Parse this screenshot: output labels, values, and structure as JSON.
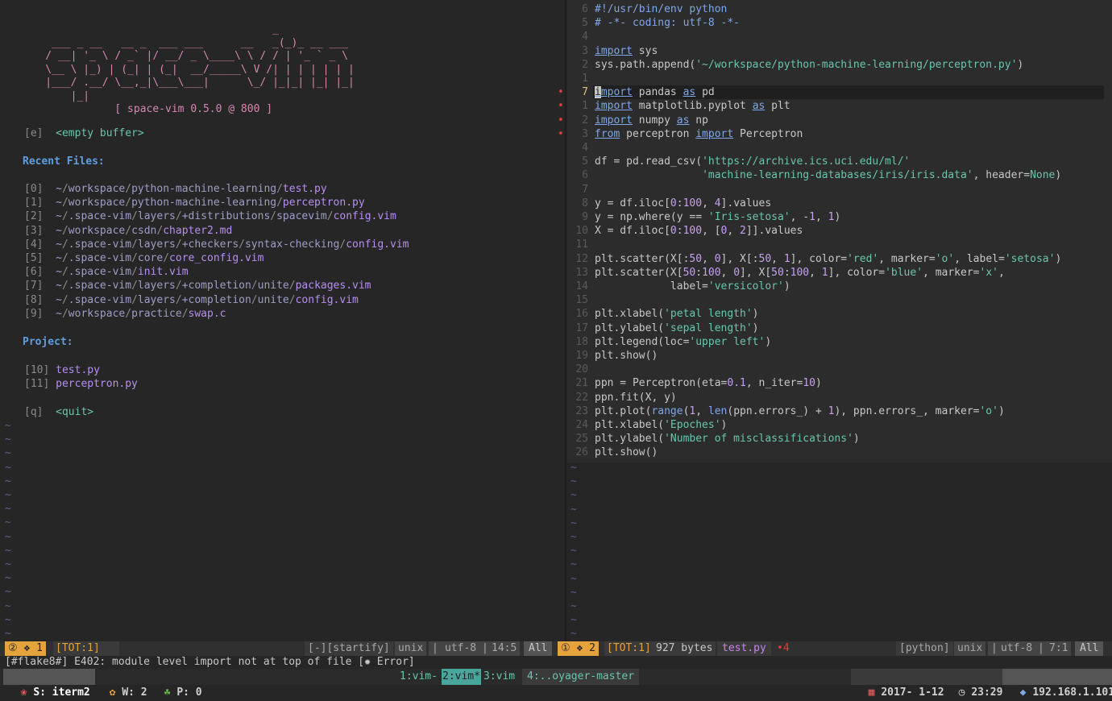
{
  "startify": {
    "banner": [
      "                                        _",
      "     ___ _ __   __ _  ___ ___      __   _(_)_ __ ___",
      "    / __| '_ \\ / _` |/ __/ _ \\____\\ \\ / / | '_ ` _ \\",
      "    \\__ \\ |_) | (_| | (_|  __/_____\\ V /| | | | | | |",
      "    |___/ .__/ \\__,_|\\___\\___|      \\_/ |_|_| |_| |_|",
      "        |_|",
      "               [ space-vim 0.5.0 @ 800 ]"
    ],
    "empty_key": "[e]",
    "empty_label": "<empty buffer>",
    "recent_header": "Recent Files:",
    "recent": [
      {
        "key": "[0]",
        "dir": "~/workspace/python-machine-learning/",
        "file": "test.py"
      },
      {
        "key": "[1]",
        "dir": "~/workspace/python-machine-learning/",
        "file": "perceptron.py"
      },
      {
        "key": "[2]",
        "dir": "~/.space-vim/layers/+distributions/spacevim/",
        "file": "config.vim"
      },
      {
        "key": "[3]",
        "dir": "~/workspace/csdn/",
        "file": "chapter2.md"
      },
      {
        "key": "[4]",
        "dir": "~/.space-vim/layers/+checkers/syntax-checking/",
        "file": "config.vim"
      },
      {
        "key": "[5]",
        "dir": "~/.space-vim/core/",
        "file": "core_config.vim"
      },
      {
        "key": "[6]",
        "dir": "~/.space-vim/",
        "file": "init.vim"
      },
      {
        "key": "[7]",
        "dir": "~/.space-vim/layers/+completion/unite/",
        "file": "packages.vim"
      },
      {
        "key": "[8]",
        "dir": "~/.space-vim/layers/+completion/unite/",
        "file": "config.vim"
      },
      {
        "key": "[9]",
        "dir": "~/workspace/practice/",
        "file": "swap.c"
      }
    ],
    "project_header": "Project:",
    "project": [
      {
        "key": "[10]",
        "file": "test.py"
      },
      {
        "key": "[11]",
        "file": "perceptron.py"
      }
    ],
    "quit_key": "[q]",
    "quit_label": "<quit>",
    "tilde": "~"
  },
  "editor": {
    "lines": [
      {
        "n": "6",
        "segs": [
          [
            "#!/usr/bin/env python",
            "kw2"
          ]
        ]
      },
      {
        "n": "5",
        "segs": [
          [
            "# -*- coding: utf-8 -*-",
            "kw2"
          ]
        ]
      },
      {
        "n": "4",
        "segs": []
      },
      {
        "n": "3",
        "segs": [
          [
            "import",
            "kw"
          ],
          [
            " sys",
            ""
          ]
        ]
      },
      {
        "n": "2",
        "segs": [
          [
            "sys.path.append(",
            ""
          ],
          [
            "'~/workspace/python-machine-learning/perceptron.py'",
            "str"
          ],
          [
            ")",
            ""
          ]
        ]
      },
      {
        "n": "1",
        "segs": []
      },
      {
        "n": "7",
        "cur": true,
        "dot": true,
        "segs": [
          [
            "import",
            "kw"
          ],
          [
            " pandas ",
            ""
          ],
          [
            "as",
            "kw"
          ],
          [
            " pd",
            ""
          ]
        ]
      },
      {
        "n": "1",
        "dot": true,
        "segs": [
          [
            "import",
            "kw"
          ],
          [
            " matplotlib.pyplot ",
            ""
          ],
          [
            "as",
            "kw"
          ],
          [
            " plt",
            ""
          ]
        ]
      },
      {
        "n": "2",
        "dot": true,
        "segs": [
          [
            "import",
            "kw"
          ],
          [
            " numpy ",
            ""
          ],
          [
            "as",
            "kw"
          ],
          [
            " np",
            ""
          ]
        ]
      },
      {
        "n": "3",
        "dot": true,
        "segs": [
          [
            "from",
            "kw"
          ],
          [
            " perceptron ",
            ""
          ],
          [
            "import",
            "kw"
          ],
          [
            " Perceptron",
            ""
          ]
        ]
      },
      {
        "n": "4",
        "segs": []
      },
      {
        "n": "5",
        "segs": [
          [
            "df = pd.read_csv(",
            ""
          ],
          [
            "'https://archive.ics.uci.edu/ml/'",
            "str"
          ]
        ]
      },
      {
        "n": "6",
        "segs": [
          [
            "                 ",
            ""
          ],
          [
            "'machine-learning-databases/iris/iris.data'",
            "str"
          ],
          [
            ", header=",
            ""
          ],
          [
            "None",
            "str"
          ],
          [
            ")",
            ""
          ]
        ]
      },
      {
        "n": "7",
        "segs": []
      },
      {
        "n": "8",
        "segs": [
          [
            "y = df.iloc[",
            ""
          ],
          [
            "0",
            "num"
          ],
          [
            ":",
            ""
          ],
          [
            "100",
            "num"
          ],
          [
            ", ",
            ""
          ],
          [
            "4",
            "num"
          ],
          [
            "].values",
            ""
          ]
        ]
      },
      {
        "n": "9",
        "segs": [
          [
            "y = np.where(y == ",
            ""
          ],
          [
            "'Iris-setosa'",
            "str"
          ],
          [
            ", -",
            ""
          ],
          [
            "1",
            "num"
          ],
          [
            ", ",
            ""
          ],
          [
            "1",
            "num"
          ],
          [
            ")",
            ""
          ]
        ]
      },
      {
        "n": "10",
        "segs": [
          [
            "X = df.iloc[",
            ""
          ],
          [
            "0",
            "num"
          ],
          [
            ":",
            ""
          ],
          [
            "100",
            "num"
          ],
          [
            ", [",
            ""
          ],
          [
            "0",
            "num"
          ],
          [
            ", ",
            ""
          ],
          [
            "2",
            "num"
          ],
          [
            "]].values",
            ""
          ]
        ]
      },
      {
        "n": "11",
        "segs": []
      },
      {
        "n": "12",
        "segs": [
          [
            "plt.scatter(X[:",
            ""
          ],
          [
            "50",
            "num"
          ],
          [
            ", ",
            ""
          ],
          [
            "0",
            "num"
          ],
          [
            "], X[:",
            ""
          ],
          [
            "50",
            "num"
          ],
          [
            ", ",
            ""
          ],
          [
            "1",
            "num"
          ],
          [
            "], color=",
            ""
          ],
          [
            "'red'",
            "str"
          ],
          [
            ", marker=",
            ""
          ],
          [
            "'o'",
            "str"
          ],
          [
            ", label=",
            ""
          ],
          [
            "'setosa'",
            "str"
          ],
          [
            ")",
            ""
          ]
        ]
      },
      {
        "n": "13",
        "segs": [
          [
            "plt.scatter(X[",
            ""
          ],
          [
            "50",
            "num"
          ],
          [
            ":",
            ""
          ],
          [
            "100",
            "num"
          ],
          [
            ", ",
            ""
          ],
          [
            "0",
            "num"
          ],
          [
            "], X[",
            ""
          ],
          [
            "50",
            "num"
          ],
          [
            ":",
            ""
          ],
          [
            "100",
            "num"
          ],
          [
            ", ",
            ""
          ],
          [
            "1",
            "num"
          ],
          [
            "], color=",
            ""
          ],
          [
            "'blue'",
            "str"
          ],
          [
            ", marker=",
            ""
          ],
          [
            "'x'",
            "str"
          ],
          [
            ",",
            ""
          ]
        ]
      },
      {
        "n": "14",
        "segs": [
          [
            "            label=",
            ""
          ],
          [
            "'versicolor'",
            "str"
          ],
          [
            ")",
            ""
          ]
        ]
      },
      {
        "n": "15",
        "segs": []
      },
      {
        "n": "16",
        "segs": [
          [
            "plt.xlabel(",
            ""
          ],
          [
            "'petal length'",
            "str"
          ],
          [
            ")",
            ""
          ]
        ]
      },
      {
        "n": "17",
        "segs": [
          [
            "plt.ylabel(",
            ""
          ],
          [
            "'sepal length'",
            "str"
          ],
          [
            ")",
            ""
          ]
        ]
      },
      {
        "n": "18",
        "segs": [
          [
            "plt.legend(loc=",
            ""
          ],
          [
            "'upper left'",
            "str"
          ],
          [
            ")",
            ""
          ]
        ]
      },
      {
        "n": "19",
        "segs": [
          [
            "plt.show()",
            ""
          ]
        ]
      },
      {
        "n": "20",
        "segs": []
      },
      {
        "n": "21",
        "segs": [
          [
            "ppn = Perceptron(eta=",
            ""
          ],
          [
            "0.1",
            "num"
          ],
          [
            ", n_iter=",
            ""
          ],
          [
            "10",
            "num"
          ],
          [
            ")",
            ""
          ]
        ]
      },
      {
        "n": "22",
        "segs": [
          [
            "ppn.fit(X, y)",
            ""
          ]
        ]
      },
      {
        "n": "23",
        "segs": [
          [
            "plt.plot(",
            ""
          ],
          [
            "range",
            "kw2"
          ],
          [
            "(",
            ""
          ],
          [
            "1",
            "num"
          ],
          [
            ", ",
            ""
          ],
          [
            "len",
            "kw2"
          ],
          [
            "(ppn.errors_) + ",
            ""
          ],
          [
            "1",
            "num"
          ],
          [
            "), ppn.errors_, marker=",
            ""
          ],
          [
            "'o'",
            "str"
          ],
          [
            ")",
            ""
          ]
        ]
      },
      {
        "n": "24",
        "segs": [
          [
            "plt.xlabel(",
            ""
          ],
          [
            "'Epoches'",
            "str"
          ],
          [
            ")",
            ""
          ]
        ]
      },
      {
        "n": "25",
        "segs": [
          [
            "plt.ylabel(",
            ""
          ],
          [
            "'Number of misclassifications'",
            "str"
          ],
          [
            ")",
            ""
          ]
        ]
      },
      {
        "n": "26",
        "segs": [
          [
            "plt.show()",
            ""
          ]
        ]
      }
    ]
  },
  "statusbar_left": {
    "win": "② ❖ 1",
    "tot": "[TOT:1]",
    "ft": "[-][startify]",
    "fmt": "unix",
    "enc": "utf-8",
    "pos": "14:5",
    "pct": "All"
  },
  "statusbar_right": {
    "win": "① ❖ 2",
    "tot": "[TOT:1]",
    "size": "927 bytes",
    "file": "test.py",
    "err": "•4",
    "ft": "[python]",
    "fmt": "unix",
    "enc": "utf-8",
    "pos": "7:1",
    "pct": "All"
  },
  "message": "[#flake8#] E402: module level import not at top of file [✹ Error]",
  "tmux": {
    "session": "S: iterm2",
    "windows_count": "W: 2",
    "panes_count": "P: 0",
    "tabs": [
      "1:vim-",
      "2:vim*",
      "3:vim",
      "4:..oyager-master"
    ],
    "active_tab": 1,
    "date": "2017- 1-12",
    "time": "23:29",
    "ip": "192.168.1.101"
  },
  "colors": {
    "accent_orange": "#e5a33b",
    "accent_teal": "#4aa59d",
    "bar_dark": "#3a3a3a"
  }
}
